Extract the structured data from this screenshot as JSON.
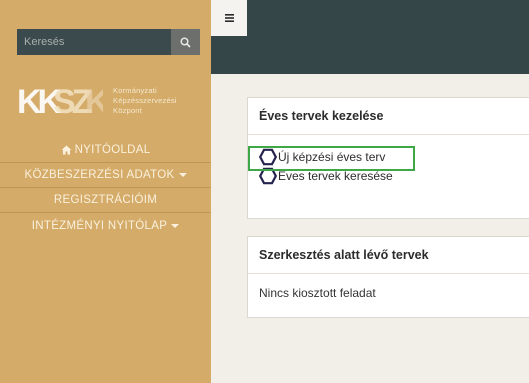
{
  "sidebar": {
    "search_placeholder": "Keresés",
    "logo": {
      "letters": "KKSZK",
      "line1": "Kormányzati",
      "line2": "Képzésszervezési",
      "line3": "Központ"
    },
    "items": [
      {
        "label": "NYITÓOLDAL",
        "icon": "home-icon"
      },
      {
        "label": "KÖZBESZERZÉSI ADATOK",
        "dropdown": true
      },
      {
        "label": "REGISZTRÁCIÓIM"
      },
      {
        "label": "INTÉZMÉNYI NYITÓLAP",
        "dropdown": true
      }
    ]
  },
  "topbar": {
    "menu_icon": "hamburger-icon"
  },
  "annual_plans": {
    "title": "Éves tervek kezelése",
    "links": [
      {
        "label": "Új képzési éves terv",
        "icon": "hexagon-icon"
      },
      {
        "label": "Éves tervek keresése",
        "icon": "hexagon-icon"
      }
    ]
  },
  "editing_plans": {
    "title": "Szerkesztés alatt lévő tervek",
    "empty_text": "Nincs kiosztott feladat"
  },
  "colors": {
    "sidebar": "#d4ab68",
    "topbar": "#354648",
    "highlight": "#3ea746",
    "content_bg": "#f2efe9"
  }
}
